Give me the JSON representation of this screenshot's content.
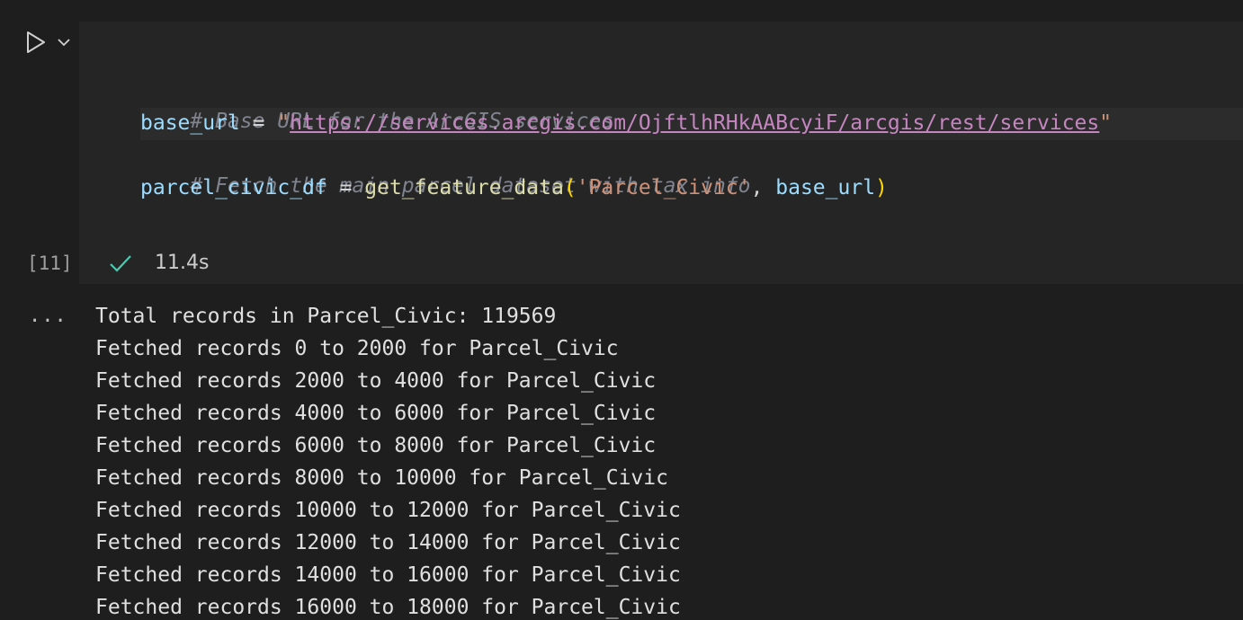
{
  "cell": {
    "code_lines": [
      {
        "comment": "# Base URL for the ArcGIS services"
      },
      {
        "var": "base_url",
        "op": " = ",
        "quote_open": "\"",
        "url": "https://services.arcgis.com/OjftlhRHkAABcyiF/arcgis/rest/services",
        "quote_close": "\""
      },
      {
        "comment": "# Fetch the main parcel dataset with tax info"
      },
      {
        "var": "parcel_civic_df",
        "op": " = ",
        "fn": "get_feature_data",
        "paren_open": "(",
        "arg1": "'Parcel_Civic'",
        "sep": ", ",
        "arg2": "base_url",
        "paren_close": ")"
      }
    ],
    "execution_count": "[11]",
    "status": "success",
    "duration": "11.4s",
    "run_icon": "play-icon",
    "dropdown_icon": "chevron-down-icon"
  },
  "output": {
    "menu_label": "...",
    "lines": [
      "Total records in Parcel_Civic: 119569",
      "Fetched records 0 to 2000 for Parcel_Civic",
      "Fetched records 2000 to 4000 for Parcel_Civic",
      "Fetched records 4000 to 6000 for Parcel_Civic",
      "Fetched records 6000 to 8000 for Parcel_Civic",
      "Fetched records 8000 to 10000 for Parcel_Civic",
      "Fetched records 10000 to 12000 for Parcel_Civic",
      "Fetched records 12000 to 14000 for Parcel_Civic",
      "Fetched records 14000 to 16000 for Parcel_Civic",
      "Fetched records 16000 to 18000 for Parcel_Civic"
    ]
  },
  "colors": {
    "background": "#1e1e1e",
    "editor_background": "#252526",
    "success": "#4ec9b0"
  }
}
